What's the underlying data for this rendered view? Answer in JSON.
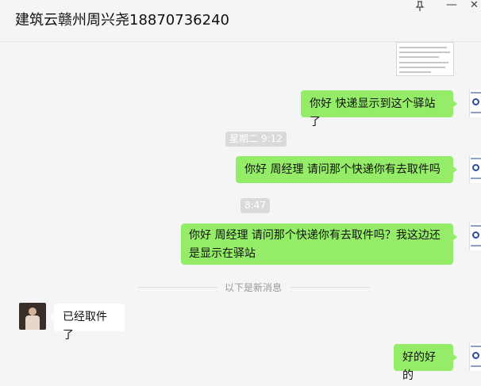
{
  "header": {
    "title": "建筑云赣州周兴尧18870736240",
    "pin_icon": "pin-icon",
    "minimize_icon": "minimize-icon",
    "close_icon": "close-icon"
  },
  "messages": [
    {
      "sender": "self",
      "text": "你好 快递显示到这个驿站了"
    },
    {
      "type": "time",
      "text": "星期二 9:12"
    },
    {
      "sender": "self",
      "text": "你好  周经理  请问那个快递你有去取件吗"
    },
    {
      "type": "time",
      "text": "8:47"
    },
    {
      "sender": "self",
      "text_line1": "你好  周经理  请问那个快递你有去取件吗？我这边还",
      "text_line2": "是显示在驿站"
    },
    {
      "type": "divider",
      "text": "以下是新消息"
    },
    {
      "sender": "other",
      "text": "已经取件了"
    },
    {
      "sender": "self",
      "text": "好的好的"
    }
  ],
  "colors": {
    "self_bubble": "#95ec69",
    "other_bubble": "#ffffff",
    "background": "#f5f5f5"
  }
}
